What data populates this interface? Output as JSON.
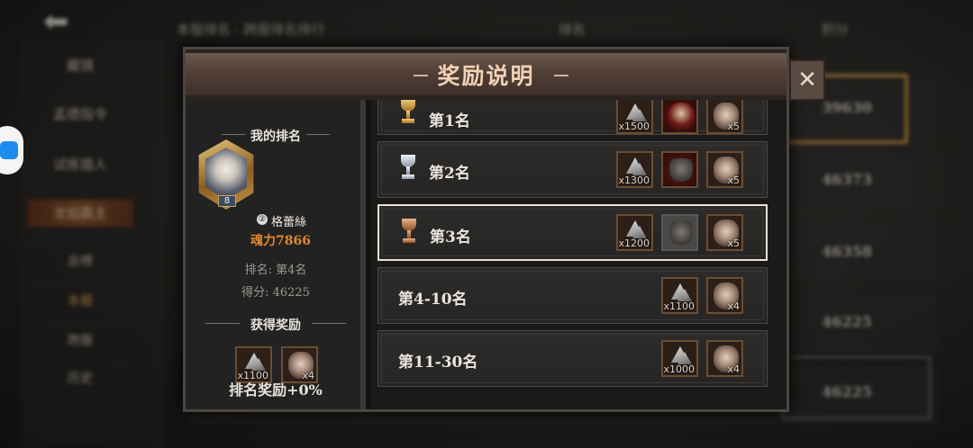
{
  "background": {
    "tabs": [
      "藏镜",
      "孟德指令",
      "试炼猎人",
      "龙焰霸主"
    ],
    "subtabs": [
      "总榜",
      "本服",
      "跨服",
      "历史"
    ],
    "headers": [
      "本服排名 · 跨服排名排行",
      "排名",
      "积分"
    ],
    "scores": [
      "39630",
      "46373",
      "46358",
      "46225",
      "46225"
    ]
  },
  "modal": {
    "title": "奖励说明",
    "close_icon": "close-icon",
    "my_rank": {
      "heading": "我的排名",
      "player_name": "格蕾絲",
      "rank_badge": "②",
      "avatar_level": "8",
      "power": "魂力7866",
      "rank_text": "排名:  第4名",
      "score_text": "得分:  46225"
    },
    "obtained": {
      "heading": "获得奖励",
      "items": [
        {
          "icon": "ore-icon",
          "qty": "x1100"
        },
        {
          "icon": "portrait-icon",
          "qty": "x4"
        }
      ]
    },
    "summary": "排名奖励+0%",
    "tiers": [
      {
        "label": "第1名",
        "trophy": "gold",
        "items": [
          {
            "icon": "ore-icon",
            "qty": "x1500"
          },
          {
            "icon": "crimson-tree-icon",
            "qty": ""
          },
          {
            "icon": "portrait-icon",
            "qty": "x5"
          }
        ]
      },
      {
        "label": "第2名",
        "trophy": "silver",
        "items": [
          {
            "icon": "ore-icon",
            "qty": "x1300"
          },
          {
            "icon": "dark-helm-icon",
            "qty": ""
          },
          {
            "icon": "portrait-icon",
            "qty": "x5"
          }
        ]
      },
      {
        "label": "第3名",
        "trophy": "bronze",
        "items": [
          {
            "icon": "ore-icon",
            "qty": "x1200"
          },
          {
            "icon": "grey-helm-icon",
            "qty": ""
          },
          {
            "icon": "portrait-icon",
            "qty": "x5"
          }
        ]
      },
      {
        "label": "第4-10名",
        "trophy": "",
        "items": [
          {
            "icon": "ore-icon",
            "qty": "x1100"
          },
          {
            "icon": "portrait-icon",
            "qty": "x4"
          }
        ]
      },
      {
        "label": "第11-30名",
        "trophy": "",
        "items": [
          {
            "icon": "ore-icon",
            "qty": "x1000"
          },
          {
            "icon": "portrait-icon",
            "qty": "x4"
          }
        ]
      }
    ]
  }
}
